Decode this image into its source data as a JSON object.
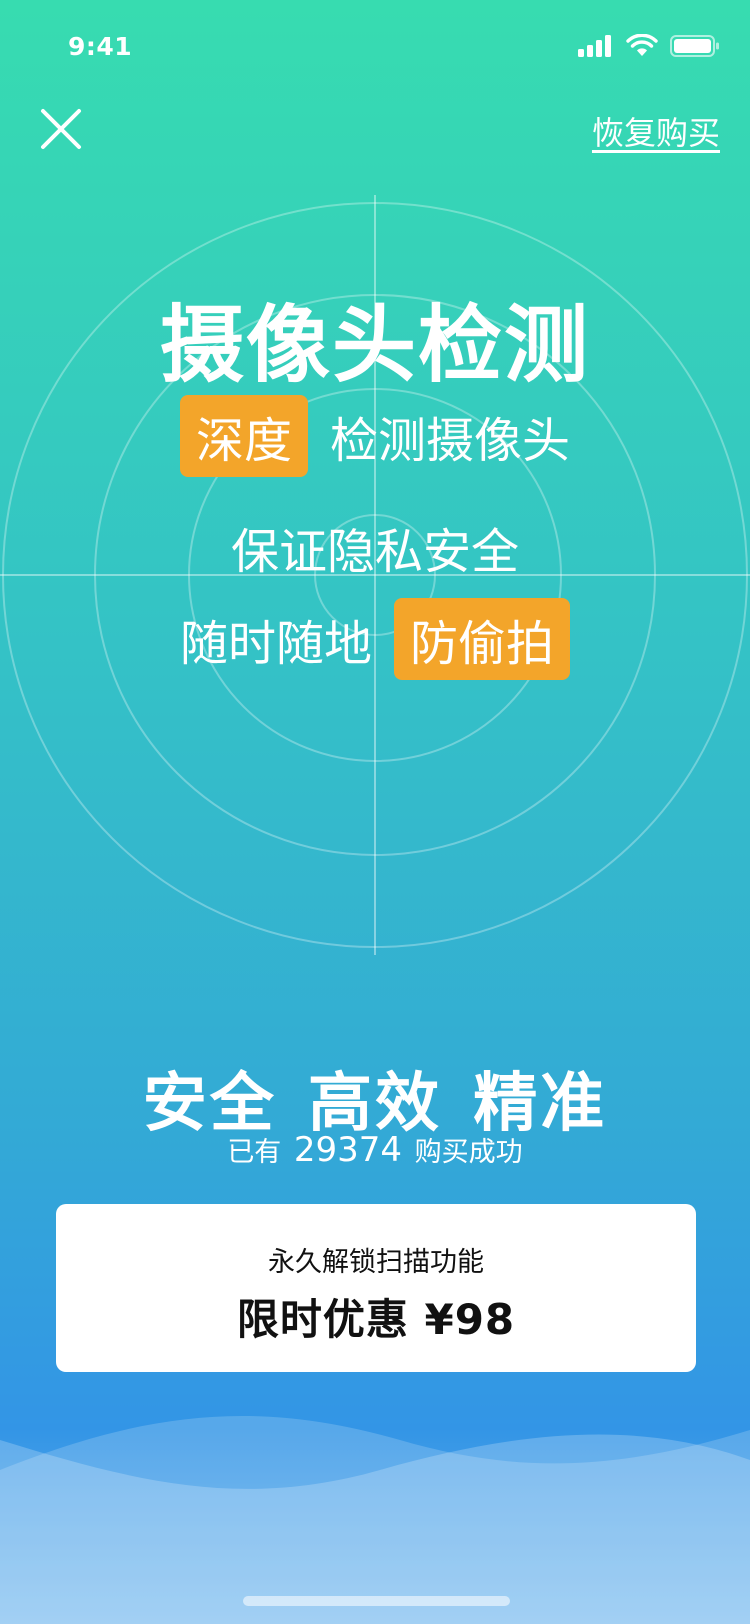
{
  "status_bar": {
    "time": "9:41",
    "icons": [
      "signal-icon",
      "wifi-icon",
      "battery-icon"
    ]
  },
  "nav": {
    "close_icon": "close-icon",
    "restore_label": "恢复购买"
  },
  "hero": {
    "title": "摄像头检测",
    "line1_tag": "深度",
    "line1_text": "检测摄像头",
    "line2_text": "保证隐私安全",
    "line3_text": "随时随地",
    "line3_tag": "防偷拍"
  },
  "features": {
    "heading": "安全 高效 精准",
    "buyers_prefix": "已有",
    "buyers_count": "29374",
    "buyers_suffix": "购买成功"
  },
  "offer": {
    "subtitle": "永久解锁扫描功能",
    "main": "限时优惠 ¥98"
  },
  "colors": {
    "gradient_top": "#37dcb0",
    "gradient_bottom": "#3395e6",
    "tag_orange": "#f3a52a",
    "card_bg": "#ffffff"
  }
}
